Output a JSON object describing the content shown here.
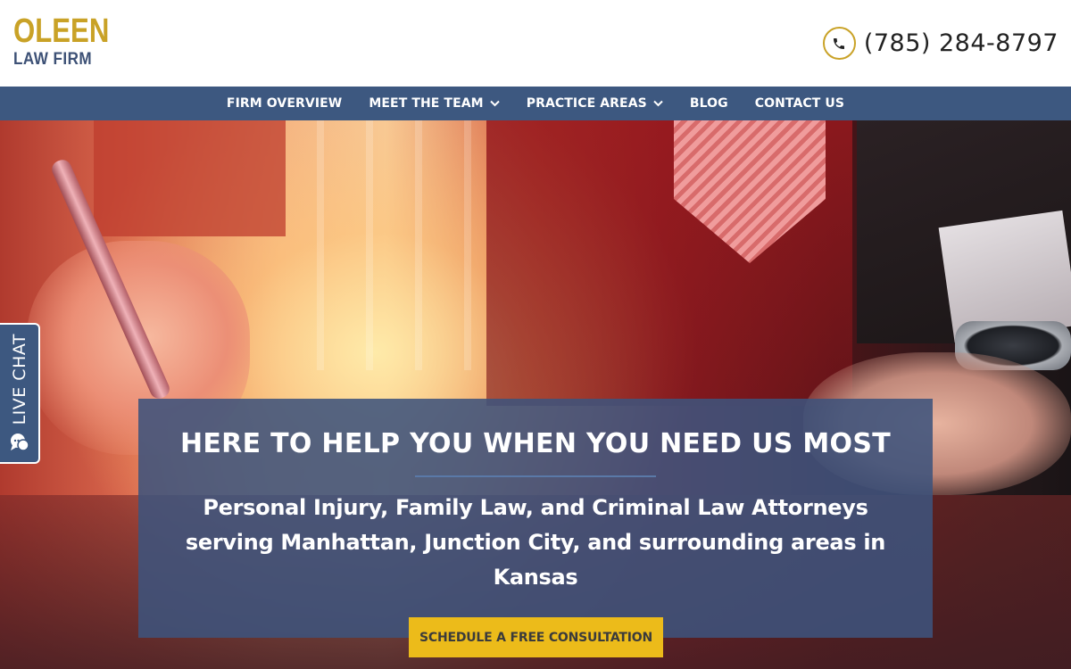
{
  "brand": {
    "logo_top": "OLEEN",
    "logo_bottom": "LAW FIRM",
    "primary_color": "#3d5880",
    "accent_color": "#c9a227"
  },
  "header": {
    "phone_icon": "phone-icon",
    "phone_number": "(785) 284-8797"
  },
  "nav": {
    "items": [
      {
        "label": "FIRM OVERVIEW",
        "has_dropdown": false
      },
      {
        "label": "MEET THE TEAM",
        "has_dropdown": true
      },
      {
        "label": "PRACTICE AREAS",
        "has_dropdown": true
      },
      {
        "label": "BLOG",
        "has_dropdown": false
      },
      {
        "label": "CONTACT US",
        "has_dropdown": false
      }
    ]
  },
  "hero": {
    "title": "HERE TO HELP YOU WHEN YOU NEED US MOST",
    "subtitle": "Personal Injury, Family Law, and Criminal Law Attorneys serving Manhattan, Junction City, and surrounding areas in Kansas",
    "cta_label": "SCHEDULE A FREE CONSULTATION",
    "cta_color": "#ecbb1a"
  },
  "live_chat": {
    "label": "LIVE CHAT",
    "icon": "chat-bubble-icon"
  }
}
